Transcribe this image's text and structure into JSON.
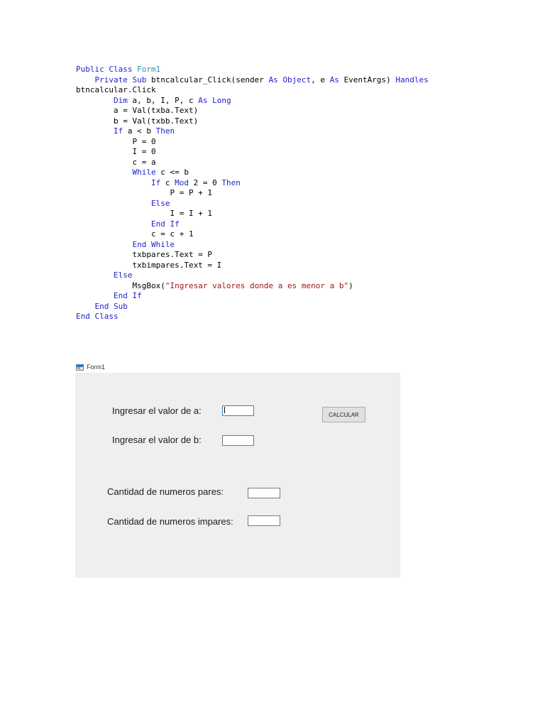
{
  "code": {
    "lines": [
      [
        {
          "t": "Public Class ",
          "c": "kw"
        },
        {
          "t": "Form1",
          "c": "ty"
        }
      ],
      [
        {
          "t": "    "
        },
        {
          "t": "Private Sub ",
          "c": "kw"
        },
        {
          "t": "btncalcular_Click(sender "
        },
        {
          "t": "As ",
          "c": "kw"
        },
        {
          "t": "Object",
          "c": "kw"
        },
        {
          "t": ", e "
        },
        {
          "t": "As ",
          "c": "kw"
        },
        {
          "t": "EventArgs) "
        },
        {
          "t": "Handles",
          "c": "kw"
        }
      ],
      [
        {
          "t": "btncalcular.Click"
        }
      ],
      [
        {
          "t": "        "
        },
        {
          "t": "Dim ",
          "c": "kw"
        },
        {
          "t": "a, b, I, P, c "
        },
        {
          "t": "As Long",
          "c": "kw"
        }
      ],
      [
        {
          "t": "        a = Val(txba.Text)"
        }
      ],
      [
        {
          "t": "        b = Val(txbb.Text)"
        }
      ],
      [
        {
          "t": "        "
        },
        {
          "t": "If ",
          "c": "kw"
        },
        {
          "t": "a < b "
        },
        {
          "t": "Then",
          "c": "kw"
        }
      ],
      [
        {
          "t": "            P = 0"
        }
      ],
      [
        {
          "t": "            I = 0"
        }
      ],
      [
        {
          "t": "            c = a"
        }
      ],
      [
        {
          "t": "            "
        },
        {
          "t": "While ",
          "c": "kw"
        },
        {
          "t": "c <= b"
        }
      ],
      [
        {
          "t": "                "
        },
        {
          "t": "If ",
          "c": "kw"
        },
        {
          "t": "c "
        },
        {
          "t": "Mod ",
          "c": "kw"
        },
        {
          "t": "2 = 0 "
        },
        {
          "t": "Then",
          "c": "kw"
        }
      ],
      [
        {
          "t": "                    P = P + 1"
        }
      ],
      [
        {
          "t": "                "
        },
        {
          "t": "Else",
          "c": "kw"
        }
      ],
      [
        {
          "t": "                    I = I + 1"
        }
      ],
      [
        {
          "t": "                "
        },
        {
          "t": "End If",
          "c": "kw"
        }
      ],
      [
        {
          "t": "                c = c + 1"
        }
      ],
      [
        {
          "t": "            "
        },
        {
          "t": "End While",
          "c": "kw"
        }
      ],
      [
        {
          "t": "            txbpares.Text = P"
        }
      ],
      [
        {
          "t": "            txbimpares.Text = I"
        }
      ],
      [
        {
          "t": "        "
        },
        {
          "t": "Else",
          "c": "kw"
        }
      ],
      [
        {
          "t": "            MsgBox("
        },
        {
          "t": "\"Ingresar valores donde a es menor a b\"",
          "c": "str"
        },
        {
          "t": ")"
        }
      ],
      [
        {
          "t": "        "
        },
        {
          "t": "End If",
          "c": "kw"
        }
      ],
      [
        {
          "t": "    "
        },
        {
          "t": "End Sub",
          "c": "kw"
        }
      ],
      [
        {
          "t": "End Class",
          "c": "kw"
        }
      ]
    ]
  },
  "form": {
    "title": "Form1",
    "label_a": "Ingresar el valor de a:",
    "label_b": "Ingresar el valor de b:",
    "label_pares": "Cantidad de numeros pares:",
    "label_impares": "Cantidad de numeros impares:",
    "button_label": "CALCULAR",
    "input_a_value": "",
    "input_b_value": "",
    "input_pares_value": "",
    "input_impares_value": ""
  }
}
